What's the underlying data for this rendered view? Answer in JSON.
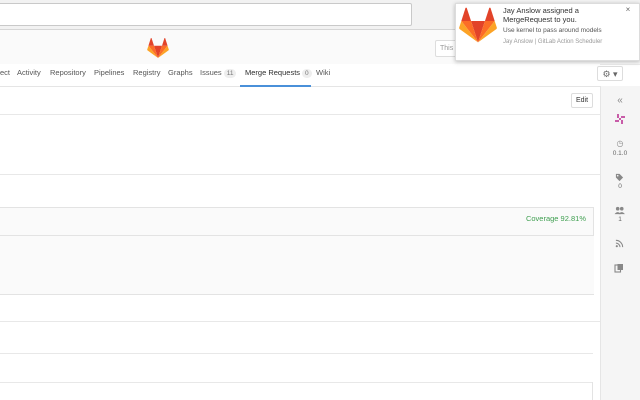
{
  "browser": {
    "menu_icon": "⋮"
  },
  "header": {
    "search_placeholder": "This p"
  },
  "nav": {
    "tabs": [
      {
        "label": "ect"
      },
      {
        "label": "Activity"
      },
      {
        "label": "Repository"
      },
      {
        "label": "Pipelines"
      },
      {
        "label": "Registry"
      },
      {
        "label": "Graphs"
      },
      {
        "label": "Issues",
        "count": "11"
      },
      {
        "label": "Merge Requests",
        "count": "0"
      },
      {
        "label": "Wiki"
      }
    ],
    "settings_icon": "⚙ ▾"
  },
  "content": {
    "edit_label": "Edit",
    "coverage": "Coverage 92.81%"
  },
  "sidebar": {
    "collapse_icon": "«",
    "milestone_value": "0.1.0",
    "labels_value": "0",
    "participants_value": "1"
  },
  "notification": {
    "title": "Jay Anslow assigned a MergeRequest to you.",
    "message": "Use kernel to pass around models",
    "source": "Jay Anslow | GitLab Action Scheduler",
    "close": "×"
  },
  "colors": {
    "accent_blue": "#4a90d9",
    "coverage_green": "#3f9f50",
    "gitlab_orange": "#e24329"
  }
}
